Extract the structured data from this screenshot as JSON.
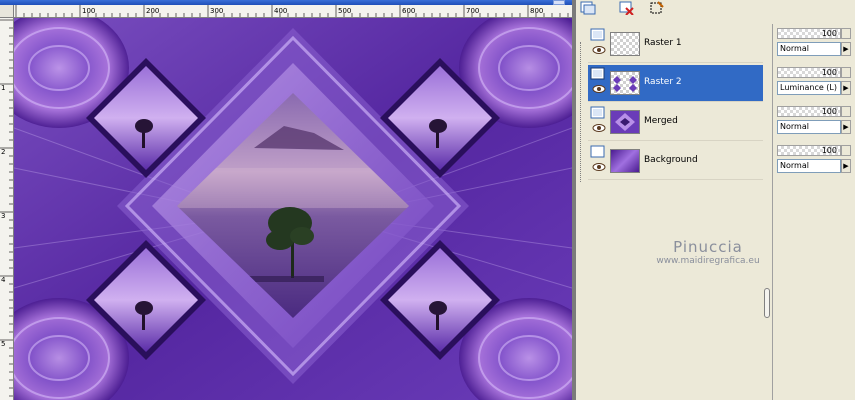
{
  "document": {
    "horizontal_ruler": {
      "labels": [
        "100",
        "200",
        "300",
        "400",
        "500",
        "600",
        "700",
        "800"
      ]
    },
    "vertical_ruler": {
      "labels": [
        "1",
        "2",
        "3",
        "4",
        "5"
      ]
    },
    "canvas": {
      "description_colors": {
        "base": "#5b2ea0",
        "light": "#b08ae0",
        "dark": "#2a0f5c",
        "sky": "#c9a6c9"
      }
    }
  },
  "layers_palette": {
    "toolbar": {
      "icons": [
        "new-layer-icon",
        "delete-layer-icon",
        "edit-selection-icon"
      ]
    },
    "layers": [
      {
        "name": "Raster 1",
        "selected": false,
        "opacity": "100",
        "blend": "Normal"
      },
      {
        "name": "Raster 2",
        "selected": true,
        "opacity": "100",
        "blend": "Luminance (L)"
      },
      {
        "name": "Merged",
        "selected": false,
        "opacity": "100",
        "blend": "Normal"
      },
      {
        "name": "Background",
        "selected": false,
        "opacity": "100",
        "blend": "Normal"
      }
    ],
    "watermark": {
      "name": "Pinuccia",
      "url": "www.maidiregrafica.eu"
    }
  }
}
